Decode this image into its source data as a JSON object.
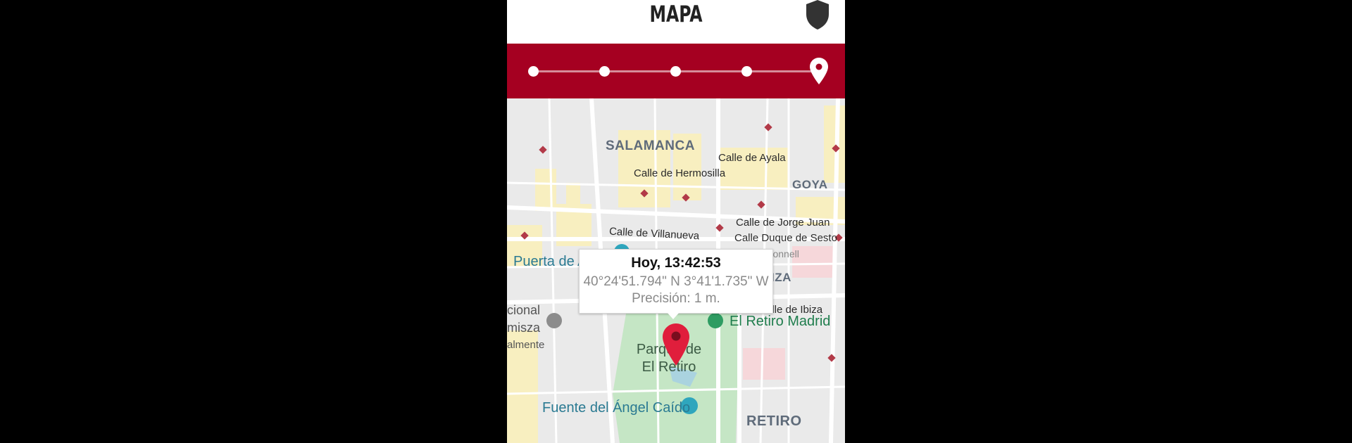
{
  "header": {
    "title": "MAPA",
    "shield_icon": "shield-icon"
  },
  "stepper": {
    "steps": 5,
    "current_step": 5,
    "current_icon": "location-pin-icon",
    "bar_color": "#a50021"
  },
  "map": {
    "districts": [
      "SALAMANCA",
      "GOYA",
      "RETIRO",
      "IZA"
    ],
    "streets": [
      "Calle de Ayala",
      "Calle de Hermosilla",
      "Calle de Jorge Juan",
      "Calle Duque de Sesto",
      "Calle de Villanueva",
      "Calle O'Donnell",
      "alle de Ibiza"
    ],
    "places": {
      "puerta": "Puerta de A",
      "retiro_madrid": "El Retiro Madrid",
      "parque": "Parque de\nEl Retiro",
      "fuente": "Fuente del Ángel Caído",
      "museo_l1": "cional",
      "museo_l2": "misza",
      "museo_l3": "almente"
    }
  },
  "popup": {
    "time": "Hoy, 13:42:53",
    "coords": "40°24'51.794\" N  3°41'1.735\" W",
    "precision": "Precisión: 1 m."
  },
  "colors": {
    "accent_red": "#a50021",
    "pin_red": "#e01e3c",
    "park_green": "#c5e6c5"
  }
}
